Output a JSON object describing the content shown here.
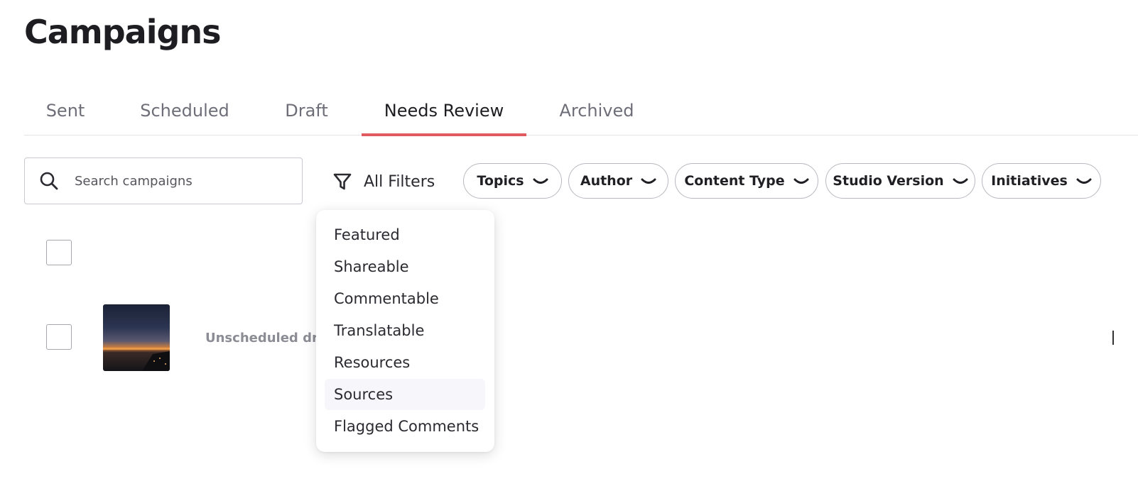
{
  "page": {
    "title": "Campaigns"
  },
  "tabs": [
    {
      "label": "Sent"
    },
    {
      "label": "Scheduled"
    },
    {
      "label": "Draft"
    },
    {
      "label": "Needs Review",
      "active": true
    },
    {
      "label": "Archived"
    }
  ],
  "search": {
    "placeholder": "Search campaigns",
    "value": ""
  },
  "filters": {
    "all_filters_label": "All Filters",
    "chips": [
      {
        "label": "Topics"
      },
      {
        "label": "Author"
      },
      {
        "label": "Content Type"
      },
      {
        "label": "Studio Version"
      },
      {
        "label": "Initiatives"
      }
    ]
  },
  "dropdown": {
    "items": [
      {
        "label": "Featured"
      },
      {
        "label": "Shareable"
      },
      {
        "label": "Commentable"
      },
      {
        "label": "Translatable"
      },
      {
        "label": "Resources"
      },
      {
        "label": "Sources",
        "hovered": true
      },
      {
        "label": "Flagged Comments"
      }
    ]
  },
  "list": {
    "rows": [
      {
        "status_text": "Unscheduled dra"
      }
    ]
  },
  "colors": {
    "accent": "#df5b5f",
    "hover": "#f6f6fb"
  }
}
